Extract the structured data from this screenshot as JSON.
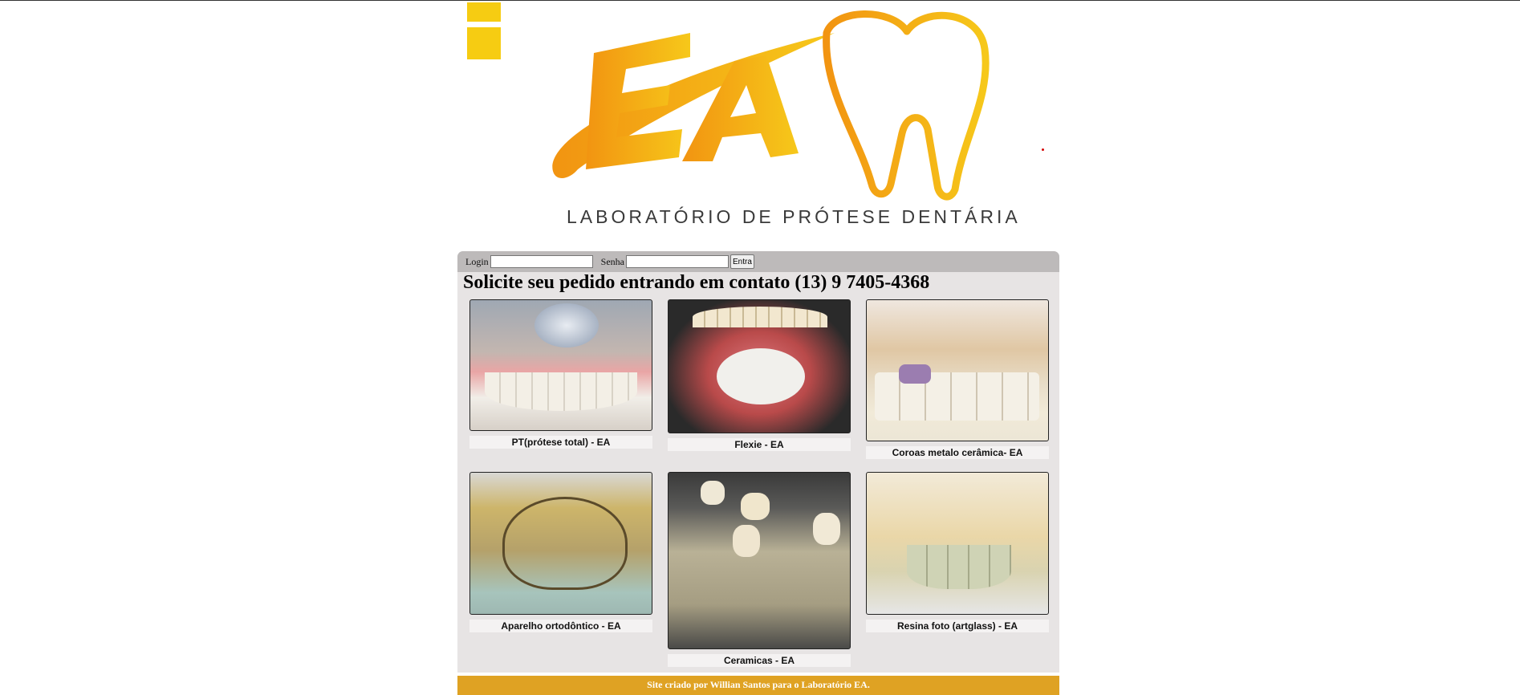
{
  "logo": {
    "letters": "EA",
    "caption": "LABORATÓRIO DE PRÓTESE DENTÁRIA",
    "colors": {
      "gold": "#f6c11a",
      "orange": "#f29411",
      "dark": "#3a3a3a"
    }
  },
  "login": {
    "login_label": "Login",
    "login_value": "",
    "senha_label": "Senha",
    "senha_value": "",
    "button_label": "Entra"
  },
  "headline": "Solicite seu pedido entrando em contato (13) 9 7405-4368",
  "products": [
    {
      "caption": "PT(prótese total) - EA",
      "icon": "denture-photo"
    },
    {
      "caption": "Flexie - EA",
      "icon": "denture-photo"
    },
    {
      "caption": "Coroas metalo cerâmica- EA",
      "icon": "crown-photo"
    },
    {
      "caption": "Aparelho ortodôntico - EA",
      "icon": "orthodontic-photo"
    },
    {
      "caption": "Ceramicas - EA",
      "icon": "ceramic-photo"
    },
    {
      "caption": "Resina foto (artglass) - EA",
      "icon": "resin-photo"
    }
  ],
  "footer": "Site criado por Willian Santos para o Laboratório EA.",
  "colors": {
    "panel": "#e7e4e4",
    "login_bar": "#bdbaba",
    "footer": "#dfa223"
  }
}
